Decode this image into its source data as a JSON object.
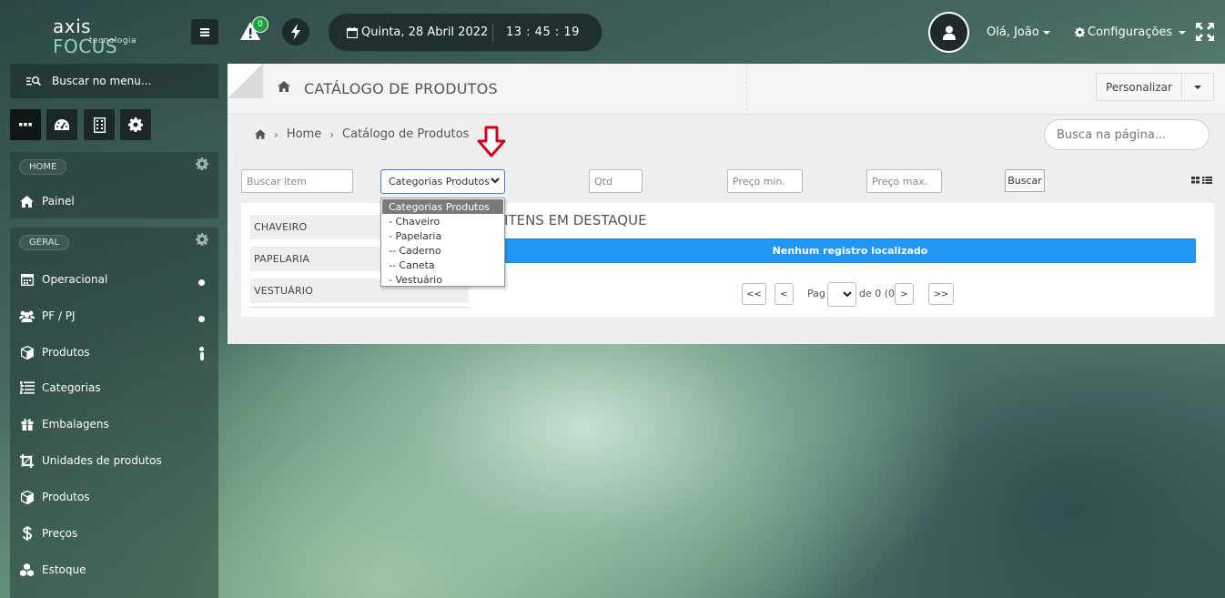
{
  "app": {
    "logo_main_1": "axis",
    "logo_main_2": "FOCUS",
    "logo_sub": "tecnologia"
  },
  "topbar": {
    "alert_count": "0",
    "date": "Quinta, 28 Abril 2022",
    "time": "13 : 45 : 19",
    "user_greeting": "Olá, João",
    "settings_label": "Configurações"
  },
  "sidebar": {
    "search_label": "Buscar no menu...",
    "home_section": "HOME",
    "general_section": "GERAL",
    "items": [
      {
        "label": "Painel",
        "icon": "home-icon"
      },
      {
        "label": "Operacional",
        "icon": "calendar-icon"
      },
      {
        "label": "PF / PJ",
        "icon": "users-icon"
      },
      {
        "label": "Produtos",
        "icon": "cube-icon"
      },
      {
        "label": "Categorias",
        "icon": "list-icon"
      },
      {
        "label": "Embalagens",
        "icon": "gift-icon"
      },
      {
        "label": "Unidades de produtos",
        "icon": "crop-icon"
      },
      {
        "label": "Produtos",
        "icon": "cube-icon"
      },
      {
        "label": "Preços",
        "icon": "dollar-icon"
      },
      {
        "label": "Estoque",
        "icon": "cubes-icon"
      }
    ]
  },
  "page": {
    "title": "CATÁLOGO DE PRODUTOS",
    "personalize_label": "Personalizar",
    "breadcrumb": [
      "Home",
      "Catálogo de Produtos"
    ],
    "page_search_placeholder": "Busca na página..."
  },
  "filters": {
    "search_item_placeholder": "Buscar item",
    "category_selected": "Categorias Produtos",
    "qty_placeholder": "Qtd",
    "price_min_placeholder": "Preço min.",
    "price_max_placeholder": "Preço max.",
    "search_button": "Buscar"
  },
  "category_options": [
    "Categorias Produtos",
    "- Chaveiro",
    "- Papelaria",
    "-- Caderno",
    "-- Caneta",
    "- Vestuário"
  ],
  "category_list": [
    "CHAVEIRO",
    "PAPELARIA",
    "VESTUÁRIO"
  ],
  "featured": {
    "title": "ITENS EM DESTAQUE",
    "no_records": "Nenhum registro localizado"
  },
  "pagination": {
    "first": "<<",
    "prev": "<",
    "page_label": "Pag",
    "of_label": "de 0 (0)",
    "next": ">",
    "last": ">>"
  },
  "colors": {
    "accent_blue": "#2196f3",
    "alert_badge": "#1fa13b",
    "arrow_red": "#d0021b"
  }
}
